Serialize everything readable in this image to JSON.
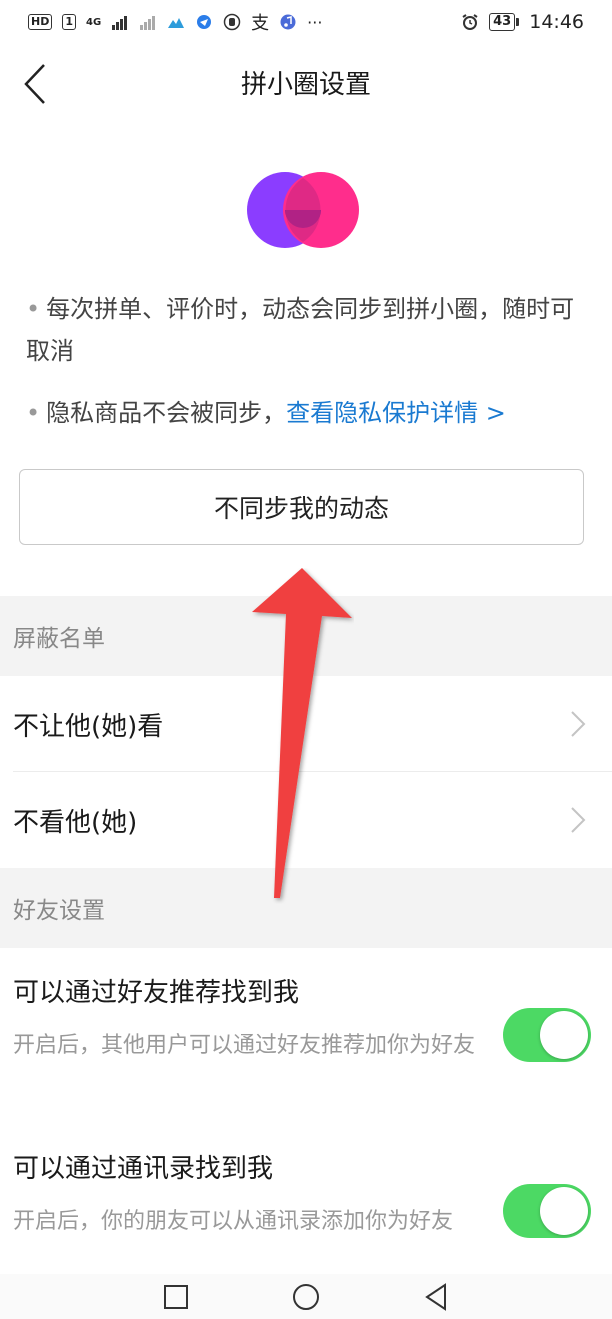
{
  "status_bar": {
    "left_chip_1": "HD",
    "left_chip_2": "1",
    "network": "4G",
    "battery": "43",
    "time": "14:46",
    "more": "···"
  },
  "nav": {
    "title": "拼小圈设置"
  },
  "info": {
    "bullet1": "每次拼单、评价时，动态会同步到拼小圈，随时可取消",
    "bullet2_text": "隐私商品不会被同步，",
    "bullet2_link": "查看隐私保护详情 >"
  },
  "sync_button": {
    "label": "不同步我的动态"
  },
  "block_list": {
    "header": "屏蔽名单",
    "items": [
      {
        "label": "不让他(她)看"
      },
      {
        "label": "不看他(她)"
      }
    ]
  },
  "friend_settings": {
    "header": "好友设置",
    "items": [
      {
        "title": "可以通过好友推荐找到我",
        "desc": "开启后，其他用户可以通过好友推荐加你为好友",
        "enabled": true
      },
      {
        "title": "可以通过通讯录找到我",
        "desc": "开启后，你的朋友可以从通讯录添加你为好友",
        "enabled": true
      }
    ]
  },
  "colors": {
    "accent_link": "#1a7ad1",
    "toggle_on": "#4cd964",
    "logo_purple": "#8b3dff",
    "logo_pink": "#ff2d8c",
    "arrow_red": "#f04040"
  }
}
